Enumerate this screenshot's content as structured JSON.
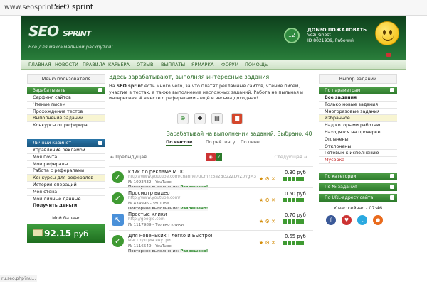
{
  "browser": {
    "url": "www.seosprint.net",
    "title": "SEO sprint"
  },
  "header": {
    "logo_main": "SEO",
    "logo_sub": "SPRINT",
    "tagline": "Всё для максимальной раскрутки!",
    "level": "12",
    "welcome": "ДОБРО ПОЖАЛОВАТЬ",
    "username": "Vezi_Ghost",
    "user_id": "ID 8021939, Рабочий"
  },
  "nav": [
    "ГЛАВНАЯ",
    "НОВОСТИ",
    "ПРАВИЛА",
    "КАРЬЕРА",
    "ОТЗЫВ",
    "ВЫПЛАТЫ",
    "ЯРМАРКА",
    "ФОРУМ",
    "ПОМОЩЬ"
  ],
  "sidebar": {
    "menu_title": "Меню пользователя",
    "earn_title": "Зарабатывать",
    "earn_items": [
      "Серфинг сайтов",
      "Чтение писем",
      "Прохождение тестов",
      "Выполнение заданий",
      "Конкурсы от реферера"
    ],
    "cab_title": "Личный кабинет",
    "cab_items": [
      "Управление рекламой",
      "Моя почта",
      "Мои рефералы",
      "Работа с рефералами",
      "Конкурсы для рефералов",
      "История операций",
      "Моя стена",
      "Мои личные данные",
      "Получить деньги"
    ],
    "balance_label": "Мой баланс",
    "balance": "92.15",
    "currency": "руб"
  },
  "main": {
    "title": "Здесь зарабатывают, выполняя интересные задания",
    "desc_pre": "На ",
    "desc_brand": "SEO sprint",
    "desc_post": " есть много чего, за что платят рекламные сайтов, чтение писем, участие в тестах, а также выполнение несложных заданий. Работа не пыльная и интересная. А вместе с рефералами - ещё и весьма доходная!",
    "earn_line": "Зарабатывай на выполнении заданий. Выбрано: 40",
    "sort": [
      "По высоте",
      "По рейтингу",
      "По цене"
    ],
    "prev": "← Предыдущая",
    "next": "Следующая →",
    "tasks": [
      {
        "title": "клик по рекламе M 001",
        "url": "http://www.youtube.com/channel/UCmYz5a2BGz2ZDvZ0vgM3A...",
        "meta": "№ 1093432 - YouTube",
        "repeat": "Повторное выполнение: ",
        "perm": "Разрешено!",
        "price": "0.30 руб"
      },
      {
        "title": "Просмотр видео",
        "url": "http://www.youtube.com/",
        "meta": "№ 434996 - YouTube",
        "repeat": "Повторное выполнение: ",
        "perm": "Разрешено!",
        "price": "0.50 руб"
      },
      {
        "title": "Простые клики",
        "url": "http://google.com",
        "meta": "№ 1117989 - Только клики",
        "repeat": "",
        "perm": "",
        "price": "0.70 руб"
      },
      {
        "title": "Для новеньких ! легко и Быстро!",
        "url": "Инструкция внутри",
        "meta": "№ 1116549 - YouTube",
        "repeat": "Повторное выполнение: ",
        "perm": "Разрешено!",
        "price": "0.65 руб"
      }
    ]
  },
  "right": {
    "title": "Выбор заданий",
    "params": "По параметрам",
    "items": [
      "Все задания",
      "Только новые задания",
      "Многоразовые задания",
      "Избранное",
      "Над которыми работаю",
      "Находятся на проверке",
      "Оплачены",
      "Отклонены",
      "Готовых к исполнению",
      "Мусорка"
    ],
    "cats": "По категории",
    "num": "По № задания",
    "url": "По URL-адресу сайта",
    "now": "У нас сейчас - 07:46"
  },
  "status": "ru.seo.php?nu..."
}
